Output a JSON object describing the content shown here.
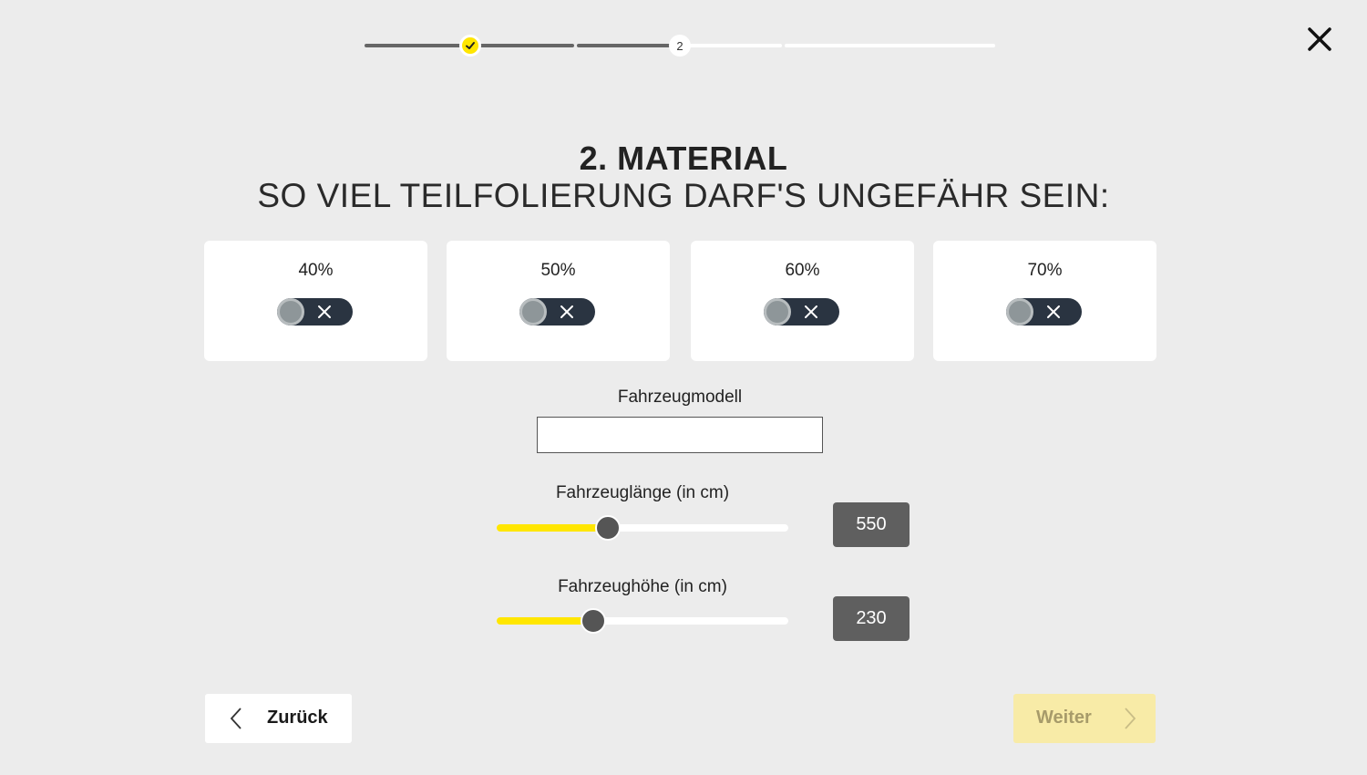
{
  "progress": {
    "step_completed_icon": "checkmark-icon",
    "current_step": "2"
  },
  "header": {
    "close_icon": "close-icon"
  },
  "title": "2. MATERIAL",
  "subtitle": "SO VIEL TEILFOLIERUNG DARF'S UNGEFÄHR SEIN:",
  "options": [
    {
      "label": "40%",
      "selected": false
    },
    {
      "label": "50%",
      "selected": false
    },
    {
      "label": "60%",
      "selected": false
    },
    {
      "label": "70%",
      "selected": false
    }
  ],
  "vehicle_model": {
    "label": "Fahrzeugmodell",
    "value": "",
    "placeholder": ""
  },
  "length": {
    "label": "Fahrzeuglänge (in cm)",
    "value": "550",
    "fraction": 0.38
  },
  "height": {
    "label": "Fahrzeughöhe (in cm)",
    "value": "230",
    "fraction": 0.33
  },
  "nav": {
    "back_label": "Zurück",
    "next_label": "Weiter"
  },
  "colors": {
    "accent": "#ffe600",
    "toggle_bg": "#2a3441",
    "value_box": "#5f5f5f",
    "next_disabled_bg": "#f8eba7"
  }
}
